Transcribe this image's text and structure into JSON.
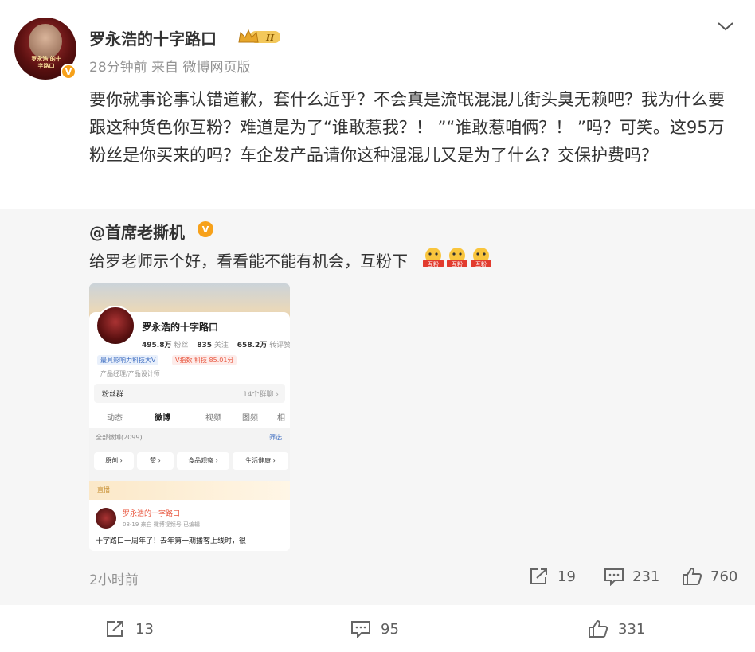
{
  "post": {
    "author": "罗永浩的十字路口",
    "avatar_text": "罗永浩\n的十字路口",
    "level_badge": "II",
    "meta": "28分钟前 来自 微博网页版",
    "text": "要你就事论事认错道歉，套什么近乎？不会真是流氓混混儿街头臭无赖吧？我为什么要跟这种货色你互粉？难道是为了“谁敢惹我？！ ”“谁敢惹咱俩？！ ”吗？可笑。这95万粉丝是你买来的吗？车企发产品请你这种混混儿又是为了什么？交保护费吗？",
    "actions": {
      "repost": "13",
      "comment": "95",
      "like": "331"
    }
  },
  "repost": {
    "author": "@首席老撕机",
    "text": "给罗老师示个好，看看能不能有机会，互粉下",
    "emoji_labels": [
      "互粉",
      "互粉",
      "互粉"
    ],
    "time": "2小时前",
    "actions": {
      "repost": "19",
      "comment": "231",
      "like": "760"
    },
    "screenshot": {
      "name": "罗永浩的十字路口",
      "fans_count": "495.8万",
      "fans_label": "粉丝",
      "follow_count": "835",
      "follow_label": "关注",
      "interactions_count": "658.2万",
      "interactions_label": "转评赞",
      "tag1": "最具影响力科技大V",
      "tag2": "V指数 科技 85.01分",
      "profession": "产品经理/产品设计师",
      "fans_group": "粉丝群",
      "fans_group_count": "14个群聊 ›",
      "tabs": [
        "动态",
        "微博",
        "视频",
        "图频",
        "相"
      ],
      "all_posts": "全部微博(2099)",
      "filter": "筛选",
      "chips": [
        "原创 ›",
        "赞 ›",
        "食品观察 ›",
        "生活健康 ›"
      ],
      "live": "直播",
      "post_name": "罗永浩的十字路口",
      "post_meta": "08-19 来自 微博视频号 已编辑",
      "post_text": "十字路口一周年了！去年第一期播客上线时，很"
    }
  },
  "colors": {
    "vip": "#f7a11a",
    "accent": "#e8553d",
    "link": "#3b6bc0",
    "muted": "#939393"
  }
}
